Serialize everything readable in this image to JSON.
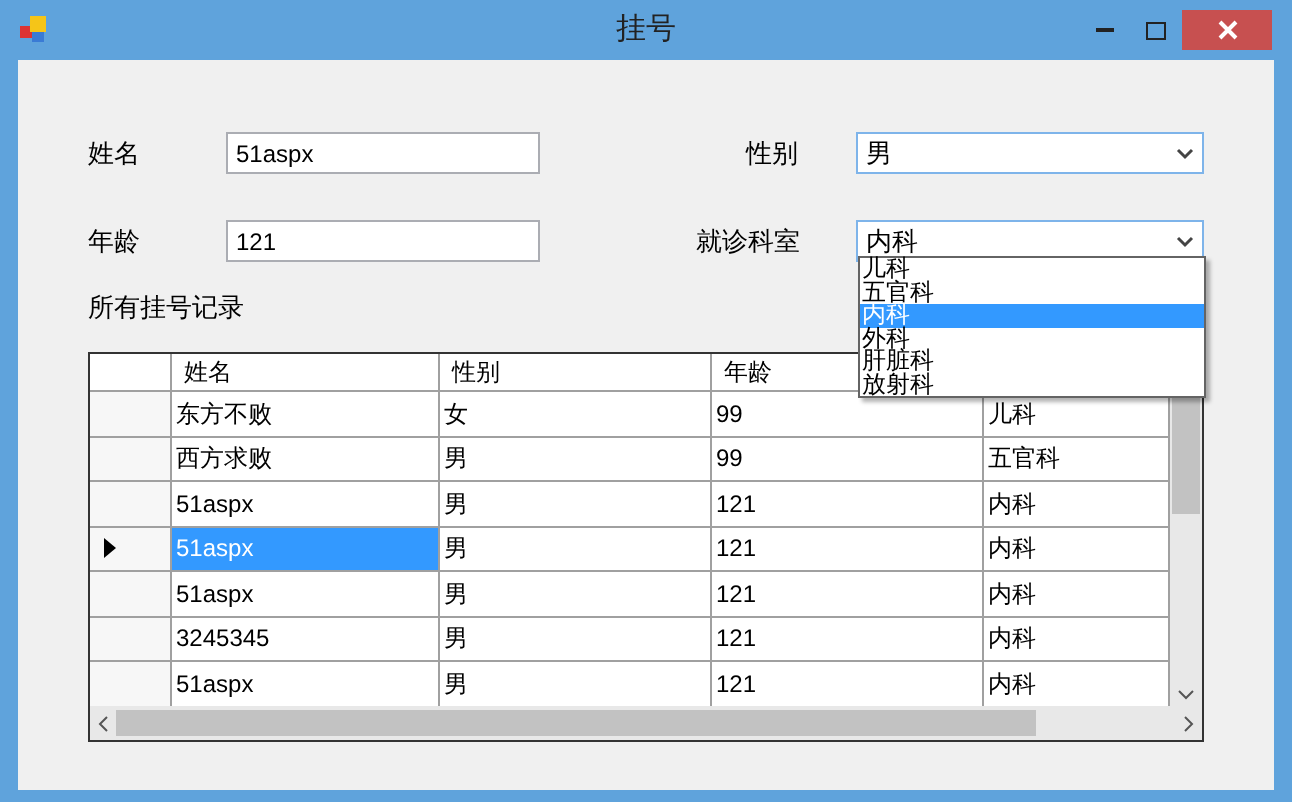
{
  "window": {
    "title": "挂号"
  },
  "form": {
    "name_label": "姓名",
    "name_value": "51aspx",
    "gender_label": "性别",
    "gender_value": "男",
    "age_label": "年龄",
    "age_value": "121",
    "dept_label": "就诊科室",
    "dept_value": "内科",
    "dept_expanded": true,
    "dept_options": [
      {
        "label": "儿科",
        "selected": false
      },
      {
        "label": "五官科",
        "selected": false
      },
      {
        "label": "内科",
        "selected": true
      },
      {
        "label": "外科",
        "selected": false
      },
      {
        "label": "肝脏科",
        "selected": false
      },
      {
        "label": "放射科",
        "selected": false
      }
    ]
  },
  "records_label": "所有挂号记录",
  "table": {
    "columns": [
      "姓名",
      "性别",
      "年龄"
    ],
    "rows": [
      {
        "cells": [
          "东方不败",
          "女",
          "99",
          "儿科"
        ],
        "selected": false
      },
      {
        "cells": [
          "西方求败",
          "男",
          "99",
          "五官科"
        ],
        "selected": false
      },
      {
        "cells": [
          "51aspx",
          "男",
          "121",
          "内科"
        ],
        "selected": false
      },
      {
        "cells": [
          "51aspx",
          "男",
          "121",
          "内科"
        ],
        "selected": true
      },
      {
        "cells": [
          "51aspx",
          "男",
          "121",
          "内科"
        ],
        "selected": false
      },
      {
        "cells": [
          "3245345",
          "男",
          "121",
          "内科"
        ],
        "selected": false
      },
      {
        "cells": [
          "51aspx",
          "男",
          "121",
          "内科"
        ],
        "selected": false
      }
    ]
  }
}
